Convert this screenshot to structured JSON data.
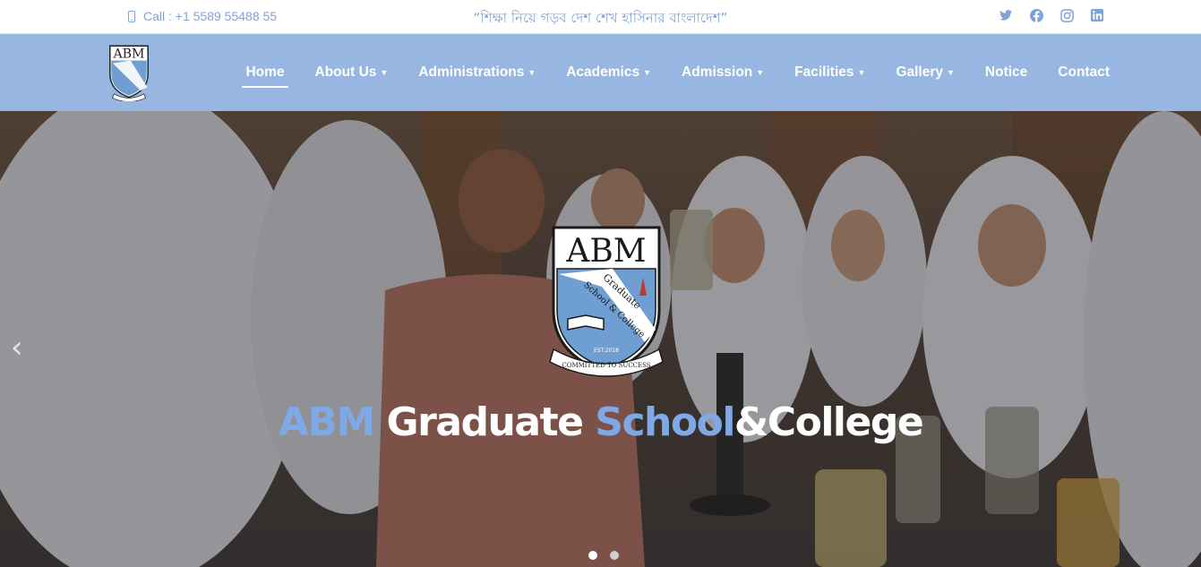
{
  "topbar": {
    "call_text": "Call : +1 5589 55488 55",
    "slogan": "“শিক্ষা নিয়ে গড়ব দেশ শেখ হাসিনার বাংলাদেশ”",
    "social": [
      "twitter-icon",
      "facebook-icon",
      "instagram-icon",
      "linkedin-icon"
    ]
  },
  "nav": {
    "items": [
      {
        "label": "Home",
        "dropdown": false,
        "active": true
      },
      {
        "label": "About Us",
        "dropdown": true
      },
      {
        "label": "Administrations",
        "dropdown": true
      },
      {
        "label": "Academics",
        "dropdown": true
      },
      {
        "label": "Admission",
        "dropdown": true
      },
      {
        "label": "Facilities",
        "dropdown": true
      },
      {
        "label": "Gallery",
        "dropdown": true
      },
      {
        "label": "Notice",
        "dropdown": false
      },
      {
        "label": "Contact",
        "dropdown": false
      }
    ]
  },
  "logo": {
    "letters": "ABM",
    "ribbon_line1": "Graduate",
    "ribbon_line2": "School & College",
    "est": "EST:2018",
    "motto": "COMMITTED TO SUCCESS"
  },
  "hero": {
    "title_part1": "ABM",
    "title_part2": "Graduate",
    "title_part3": "School",
    "title_part4": "&College",
    "prev_arrow": "‹"
  },
  "colors": {
    "accent": "#7fa3d6",
    "nav_bg": "#98b6e2",
    "title_blue": "#7fa8e6"
  }
}
